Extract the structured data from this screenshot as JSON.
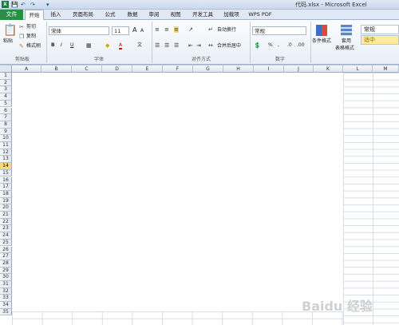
{
  "app": {
    "title": "代码.xlsx - Microsoft Excel",
    "icon": "excel-icon",
    "qat": [
      "save-icon",
      "undo-icon",
      "redo-icon",
      "customize-icon"
    ]
  },
  "tabs": [
    "文件",
    "开始",
    "插入",
    "页面布局",
    "公式",
    "数据",
    "审阅",
    "视图",
    "开发工具",
    "加载项",
    "WPS PDF"
  ],
  "active_tab": "开始",
  "ribbon": {
    "clipboard": {
      "paste": "粘贴",
      "cut": "剪切",
      "copy": "复制",
      "format_painter": "格式刷",
      "label": "剪贴板"
    },
    "font": {
      "name": "宋体",
      "size": "11",
      "grow": "A",
      "shrink": "A",
      "bold": "B",
      "italic": "I",
      "underline": "U",
      "font_color": "A",
      "phonetic": "文",
      "label": "字体"
    },
    "alignment": {
      "wrap": "自动换行",
      "merge": "合并后居中",
      "label": "对齐方式"
    },
    "number": {
      "format": "常规",
      "percent": "%",
      "comma": ",",
      "label": "数字"
    },
    "styles": {
      "conditional": "条件格式",
      "table_line1": "套用",
      "table_line2": "表格格式",
      "normal": "常规",
      "neutral": "适中"
    }
  },
  "columns": [
    "A",
    "B",
    "C",
    "D",
    "E",
    "F",
    "G",
    "H",
    "I",
    "J",
    "K",
    "L",
    "M"
  ],
  "rows": [
    "1",
    "2",
    "3",
    "4",
    "5",
    "6",
    "7",
    "8",
    "9",
    "10",
    "11",
    "12",
    "13",
    "14",
    "15",
    "16",
    "17",
    "18",
    "19",
    "20",
    "21",
    "22",
    "23",
    "24",
    "25",
    "26",
    "27",
    "28",
    "29",
    "30",
    "31",
    "32",
    "33",
    "34",
    "35"
  ],
  "selected_row": "14",
  "watermark": "Baidu 经验",
  "colors": {
    "file_tab": "#2a8f46",
    "selected_header": "#f9d77e",
    "neutral_style": "#ffeb9c"
  }
}
